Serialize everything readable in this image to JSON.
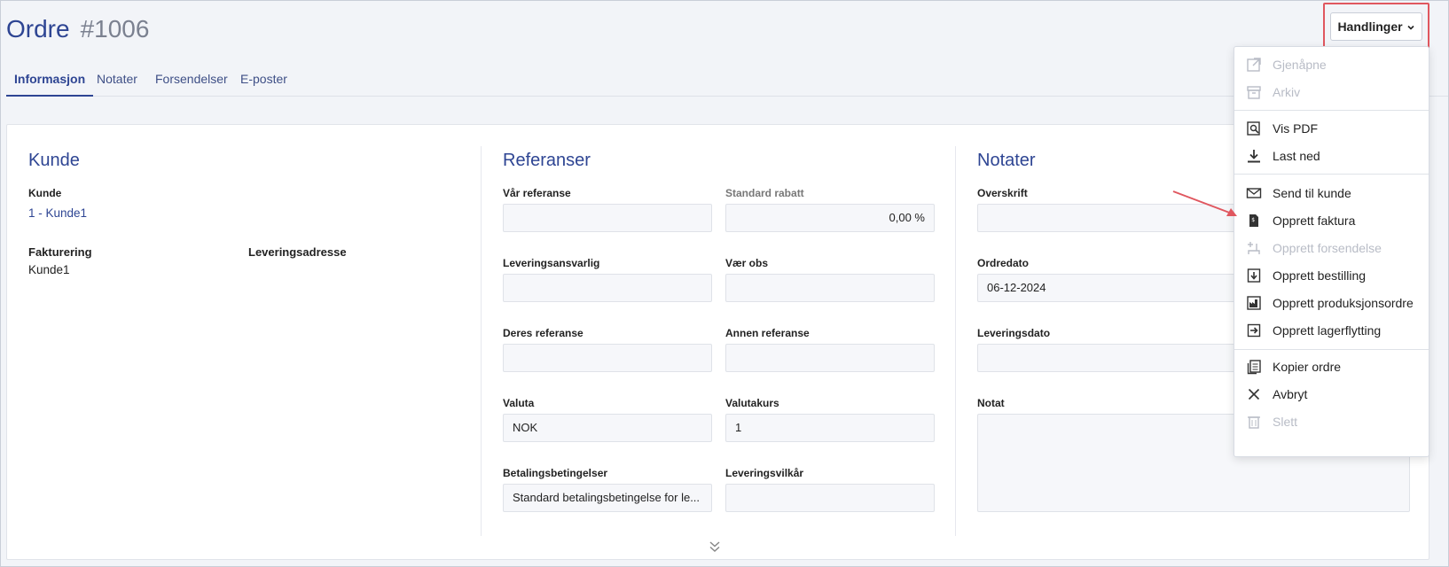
{
  "header": {
    "title": "Ordre",
    "number": "#1006",
    "actions_label": "Handlinger"
  },
  "tabs": [
    {
      "label": "Informasjon",
      "active": true
    },
    {
      "label": "Notater"
    },
    {
      "label": "Forsendelser"
    },
    {
      "label": "E-poster"
    }
  ],
  "kunde": {
    "section_title": "Kunde",
    "kunde_label": "Kunde",
    "kunde_value": "1 - Kunde1",
    "fakturering_label": "Fakturering",
    "fakturering_value": "Kunde1",
    "leveringsadresse_label": "Leveringsadresse"
  },
  "referanser": {
    "section_title": "Referanser",
    "fields": [
      {
        "label": "Vår referanse",
        "value": ""
      },
      {
        "label": "Standard rabatt",
        "value": "0,00 %",
        "muted": true
      },
      {
        "label": "Leveringsansvarlig",
        "value": ""
      },
      {
        "label": "Vær obs",
        "value": ""
      },
      {
        "label": "Deres referanse",
        "value": ""
      },
      {
        "label": "Annen referanse",
        "value": ""
      },
      {
        "label": "Valuta",
        "value": "NOK"
      },
      {
        "label": "Valutakurs",
        "value": "1"
      },
      {
        "label": "Betalingsbetingelser",
        "value": "Standard betalingsbetingelse for le..."
      },
      {
        "label": "Leveringsvilkår",
        "value": ""
      }
    ]
  },
  "notater": {
    "section_title": "Notater",
    "overskrift_label": "Overskrift",
    "overskrift_value": "",
    "ordredato_label": "Ordredato",
    "ordredato_value": "06-12-2024",
    "leveringsdato_label": "Leveringsdato",
    "leveringsdato_value": "",
    "notat_label": "Notat"
  },
  "menu": {
    "items": [
      {
        "label": "Gjenåpne",
        "icon": "external-link-icon",
        "disabled": true
      },
      {
        "label": "Arkiv",
        "icon": "archive-icon",
        "disabled": true
      },
      {
        "label": "Vis PDF",
        "icon": "search-document-icon"
      },
      {
        "label": "Last ned",
        "icon": "download-icon"
      },
      {
        "label": "Send til kunde",
        "icon": "mail-icon"
      },
      {
        "label": "Opprett faktura",
        "icon": "invoice-icon"
      },
      {
        "label": "Opprett forsendelse",
        "icon": "shipment-icon",
        "disabled": true
      },
      {
        "label": "Opprett bestilling",
        "icon": "order-icon"
      },
      {
        "label": "Opprett produksjonsordre",
        "icon": "factory-icon"
      },
      {
        "label": "Opprett lagerflytting",
        "icon": "transfer-icon"
      },
      {
        "label": "Kopier ordre",
        "icon": "copy-icon"
      },
      {
        "label": "Avbryt",
        "icon": "close-icon"
      },
      {
        "label": "Slett",
        "icon": "trash-icon",
        "disabled": true
      }
    ]
  },
  "colors": {
    "accent": "#2e4593",
    "highlight": "#e0575f",
    "disabled": "#b8bcc6"
  }
}
